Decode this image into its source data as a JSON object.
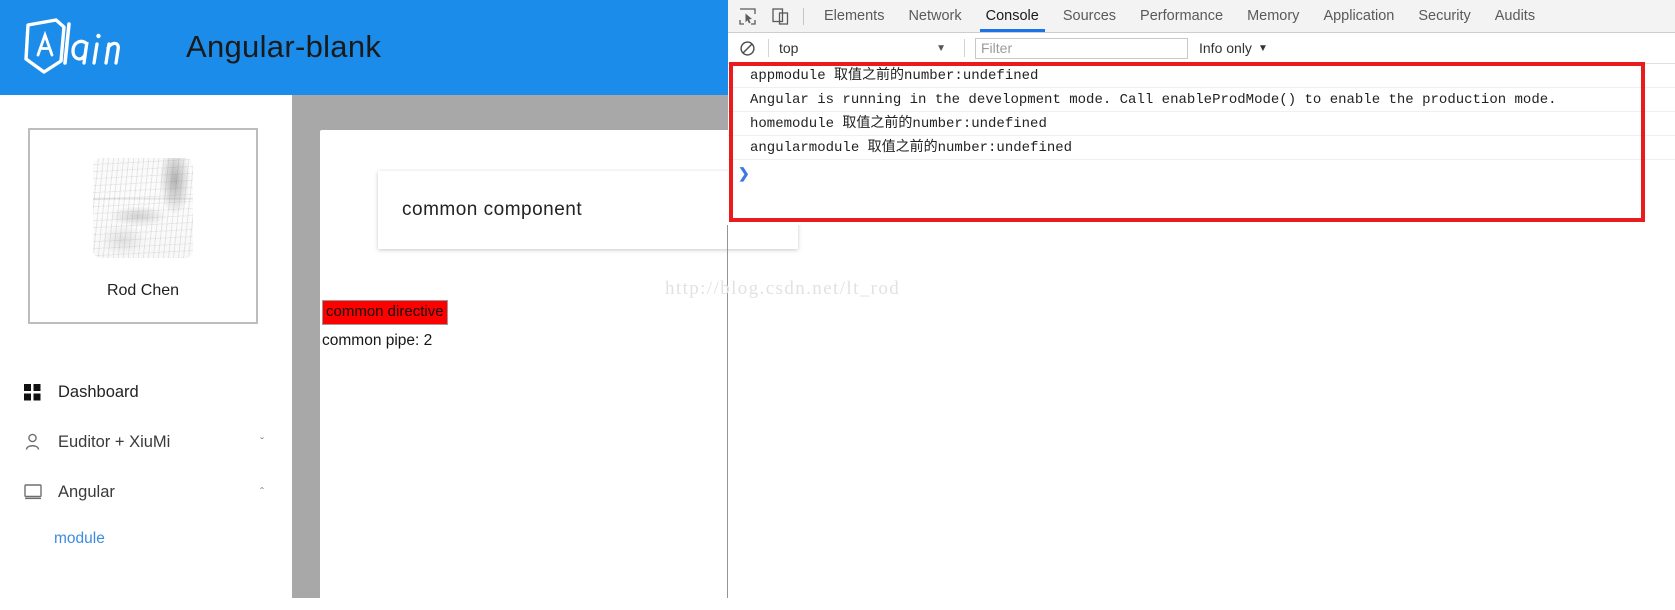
{
  "app": {
    "header": {
      "logo_text": "lain",
      "logo_icon": "angular-shield-icon",
      "title": "Angular-blank",
      "bg_color": "#1b8cea"
    },
    "sidebar": {
      "profile": {
        "avatar_icon": "user-avatar-sketch",
        "name": "Rod Chen"
      },
      "items": [
        {
          "label": "Dashboard",
          "icon": "grid-dashboard-icon",
          "chevron": "",
          "active": false
        },
        {
          "label": "Euditor + XiuMi",
          "icon": "user-person-icon",
          "chevron": "ˇ",
          "active": false
        },
        {
          "label": "Angular",
          "icon": "monitor-screen-icon",
          "chevron": "ˆ",
          "active": true
        }
      ],
      "sub_items": [
        {
          "label": "module",
          "color": "#3d8ce0"
        }
      ]
    },
    "main": {
      "component_label": "common component",
      "directive_label": "common directive",
      "directive_bg": "#ff0000",
      "pipe_text": "common pipe: 2",
      "canvas_bg": "#a8a8a8"
    },
    "watermark": "http://blog.csdn.net/lt_rod"
  },
  "devtools": {
    "toolbar": {
      "inspect_icon": "inspect-element-icon",
      "device_icon": "device-toolbar-icon",
      "tabs": [
        {
          "label": "Elements",
          "active": false
        },
        {
          "label": "Network",
          "active": false
        },
        {
          "label": "Console",
          "active": true
        },
        {
          "label": "Sources",
          "active": false
        },
        {
          "label": "Performance",
          "active": false
        },
        {
          "label": "Memory",
          "active": false
        },
        {
          "label": "Application",
          "active": false
        },
        {
          "label": "Security",
          "active": false
        },
        {
          "label": "Audits",
          "active": false
        }
      ],
      "active_tab_color": "#1a73e8"
    },
    "filterbar": {
      "clear_icon": "clear-console-icon",
      "context": "top",
      "context_caret": "▼",
      "filter_value": "",
      "filter_placeholder": "Filter",
      "level": "Info only",
      "level_caret": "▼"
    },
    "console": {
      "messages": [
        {
          "prefix": "appmodule ",
          "cjk": "取值之前的",
          "suffix": "number:undefined"
        },
        {
          "prefix": "Angular is running in the development mode. Call enableProdMode() to enable the production mode.",
          "cjk": "",
          "suffix": ""
        },
        {
          "prefix": "homemodule ",
          "cjk": "取值之前的",
          "suffix": "number:undefined"
        },
        {
          "prefix": "angularmodule ",
          "cjk": "取值之前的",
          "suffix": "number:undefined"
        }
      ],
      "prompt_symbol": "❯"
    },
    "highlight_box_color": "#e81c1c"
  }
}
